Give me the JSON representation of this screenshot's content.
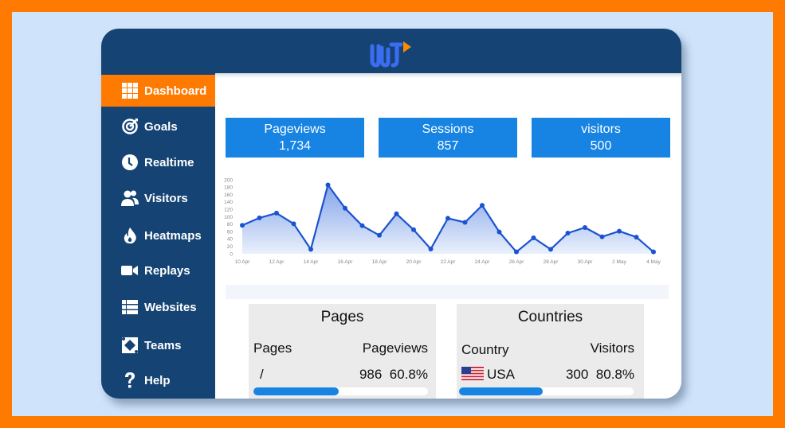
{
  "app": {
    "logo_name": "WT logo"
  },
  "colors": {
    "accent": "#ff7a00",
    "primary": "#154474",
    "stat_blue": "#1784e3",
    "background": "#cfe4fb"
  },
  "sidebar": {
    "items": [
      {
        "label": "Dashboard",
        "icon": "grid-icon",
        "active": true
      },
      {
        "label": "Goals",
        "icon": "target-icon",
        "active": false
      },
      {
        "label": "Realtime",
        "icon": "clock-icon",
        "active": false
      },
      {
        "label": "Visitors",
        "icon": "users-icon",
        "active": false
      },
      {
        "label": "Heatmaps",
        "icon": "flame-icon",
        "active": false
      },
      {
        "label": "Replays",
        "icon": "video-camera-icon",
        "active": false
      },
      {
        "label": "Websites",
        "icon": "list-icon",
        "active": false
      },
      {
        "label": "Teams",
        "icon": "teams-icon",
        "active": false
      },
      {
        "label": "Help",
        "icon": "question-icon",
        "active": false
      }
    ]
  },
  "stats": [
    {
      "label": "Pageviews",
      "value": "1,734"
    },
    {
      "label": "Sessions",
      "value": "857"
    },
    {
      "label": "visitors",
      "value": "500"
    }
  ],
  "chart_data": {
    "type": "area",
    "title": "",
    "xlabel": "",
    "ylabel": "",
    "ylim": [
      0,
      200
    ],
    "yticks": [
      "0",
      "20",
      "40",
      "60",
      "80",
      "100",
      "120",
      "140",
      "160",
      "180",
      "200"
    ],
    "xtick_labels": [
      "10 Apr",
      "12 Apr",
      "14 Apr",
      "16 Apr",
      "18 Apr",
      "20 Apr",
      "22 Apr",
      "24 Apr",
      "26 Apr",
      "28 Apr",
      "30 Apr",
      "2 May",
      "4 May"
    ],
    "x": [
      "10 Apr",
      "11 Apr",
      "12 Apr",
      "13 Apr",
      "14 Apr",
      "15 Apr",
      "16 Apr",
      "17 Apr",
      "18 Apr",
      "19 Apr",
      "20 Apr",
      "21 Apr",
      "22 Apr",
      "23 Apr",
      "24 Apr",
      "25 Apr",
      "26 Apr",
      "27 Apr",
      "28 Apr",
      "29 Apr",
      "30 Apr",
      "1 May",
      "2 May",
      "3 May",
      "4 May"
    ],
    "series": [
      {
        "name": "Pageviews",
        "values": [
          77,
          97,
          110,
          81,
          12,
          186,
          123,
          76,
          50,
          108,
          65,
          13,
          96,
          85,
          131,
          59,
          5,
          43,
          12,
          56,
          71,
          46,
          61,
          45,
          5
        ]
      }
    ],
    "grid": false,
    "legend": "none"
  },
  "pages_panel": {
    "title": "Pages",
    "col_left": "Pages",
    "col_right": "Pageviews",
    "rows": [
      {
        "name": "/",
        "count": "986",
        "percent": "60.8%",
        "fraction": 0.49
      }
    ]
  },
  "countries_panel": {
    "title": "Countries",
    "col_left": "Country",
    "col_right": "Visitors",
    "rows": [
      {
        "name": "USA",
        "flag": "us-flag-icon",
        "count": "300",
        "percent": "80.8%",
        "fraction": 0.48
      }
    ]
  }
}
